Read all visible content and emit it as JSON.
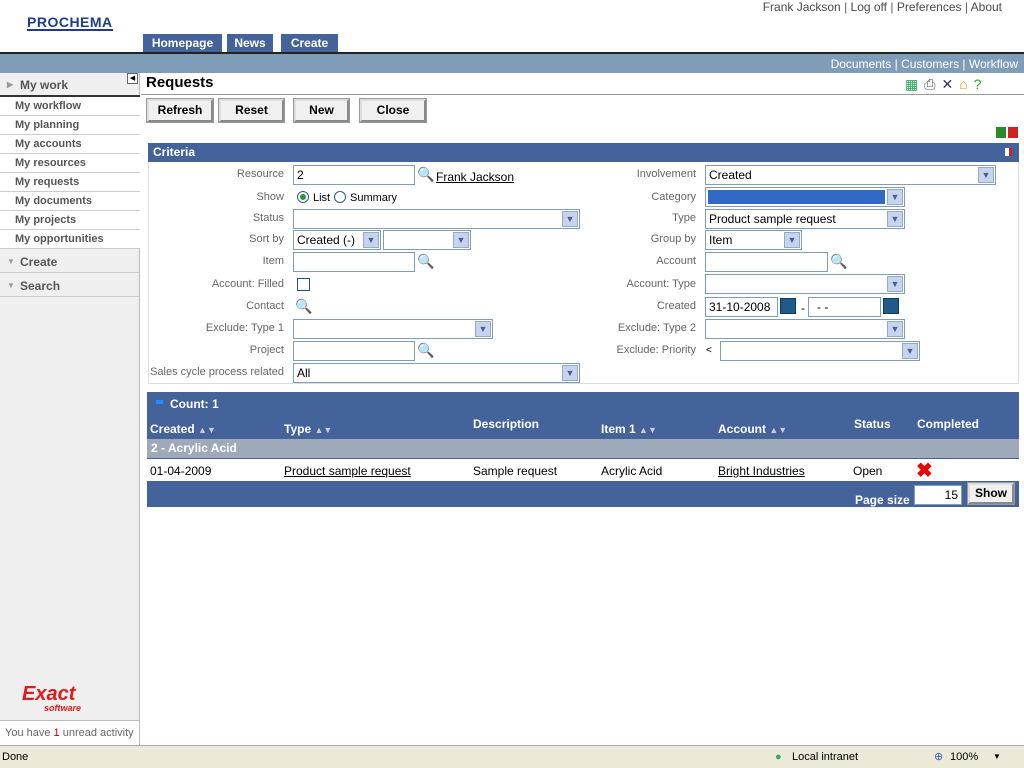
{
  "brand": "PROCHEMA",
  "top_links": [
    "Frank Jackson",
    "Log off",
    "Preferences",
    "About"
  ],
  "tabs": [
    "Homepage",
    "News",
    "Create"
  ],
  "sub_links": [
    "Documents",
    "Customers",
    "Workflow"
  ],
  "sidebar": {
    "my_work": "My work",
    "items": [
      "My workflow",
      "My planning",
      "My accounts",
      "My resources",
      "My requests",
      "My documents",
      "My projects",
      "My opportunities"
    ],
    "create": "Create",
    "search": "Search",
    "logo": "Exact software",
    "unread_pre": "You have ",
    "unread_count": "1",
    "unread_post": " unread activity"
  },
  "page_title": "Requests",
  "toolbar": {
    "refresh": "Refresh",
    "reset": "Reset",
    "new": "New",
    "close": "Close"
  },
  "criteria": {
    "title": "Criteria",
    "resource_label": "Resource",
    "resource_value": "2",
    "resource_name": "Frank Jackson",
    "show_label": "Show",
    "show_list": "List",
    "show_summary": "Summary",
    "status_label": "Status",
    "status_value": "",
    "sortby_label": "Sort by",
    "sortby_value": "Created (-)",
    "sortby2_value": "",
    "item_label": "Item",
    "item_value": "",
    "account_filled_label": "Account: Filled",
    "contact_label": "Contact",
    "exclude_type1_label": "Exclude: Type 1",
    "exclude_type1_value": "",
    "project_label": "Project",
    "project_value": "",
    "sales_cycle_label": "Sales cycle process related",
    "sales_cycle_value": "All",
    "involvement_label": "Involvement",
    "involvement_value": "Created",
    "category_label": "Category",
    "category_value": "",
    "type_label": "Type",
    "type_value": "Product sample request",
    "groupby_label": "Group by",
    "groupby_value": "Item",
    "account_label": "Account",
    "account_value": "",
    "account_type_label": "Account: Type",
    "account_type_value": "",
    "created_label": "Created",
    "created_from": "31-10-2008",
    "created_sep": "-",
    "created_to": "- -",
    "exclude_type2_label": "Exclude: Type 2",
    "exclude_type2_value": "",
    "exclude_priority_label": "Exclude: Priority",
    "exclude_priority_op": "<",
    "exclude_priority_value": ""
  },
  "results": {
    "count": "Count: 1",
    "columns": [
      "Created",
      "Type",
      "Description",
      "Item 1",
      "Account",
      "Status",
      "Completed"
    ],
    "group": "2 - Acrylic Acid",
    "rows": [
      {
        "created": "01-04-2009",
        "type": "Product sample request",
        "description": "Sample request",
        "item": "Acrylic Acid",
        "account": "Bright Industries",
        "status": "Open",
        "completed": false
      }
    ],
    "page_size_label": "Page size",
    "page_size": "15",
    "show": "Show"
  },
  "statusbar": {
    "text": "Done",
    "zone": "Local intranet",
    "zoom": "100%"
  }
}
